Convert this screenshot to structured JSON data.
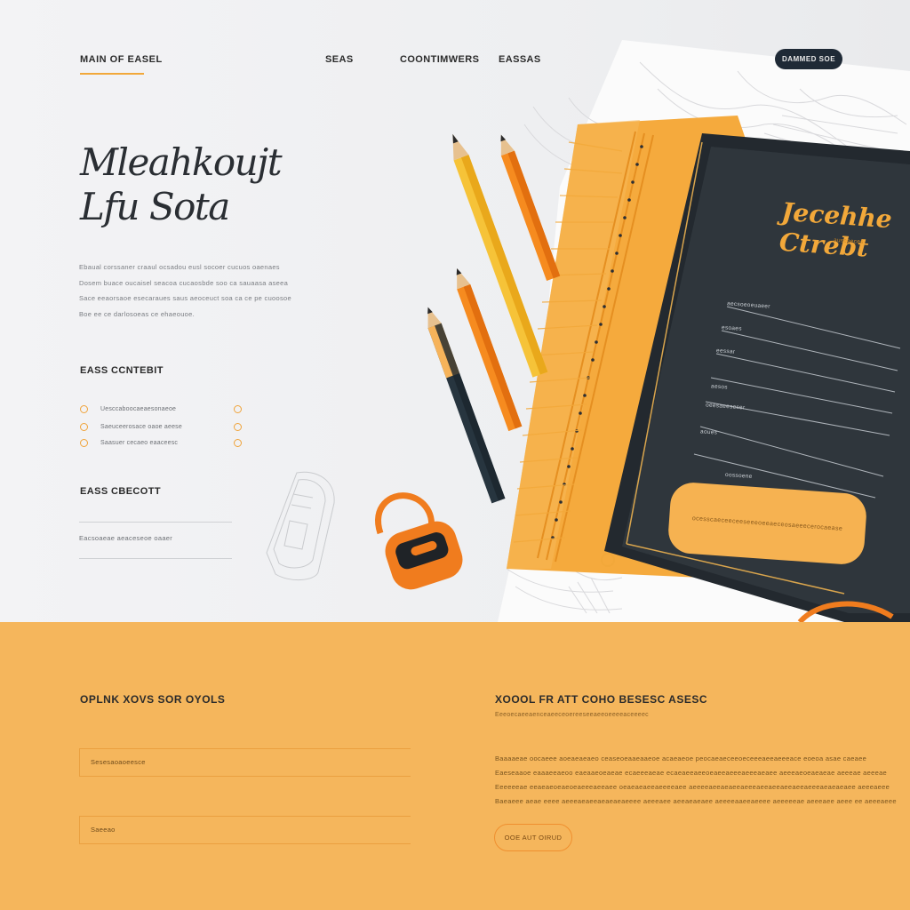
{
  "header": {
    "brand": "MAIN OF EASEL",
    "nav": [
      "SEAS",
      "COONTIMWERS",
      "EASSAS"
    ],
    "cta": "DAMMED SOE"
  },
  "hero": {
    "headline_line1": "Mleahkoujt",
    "headline_line2": "Lfu Sota",
    "paragraph": [
      "Ebaual corssaner craaul ocsadou eusl socoer cucuos oaenaes",
      "Dosem buace oucaisel seacoa cucaosbde soo ca sauaasa aseea",
      "Sace eeaorsaoe esecaraues saus aeoceuct soa ca ce pe cuoosoe",
      "Boe ee ce darlosoeas ce ehaeouoe."
    ]
  },
  "contact": {
    "title": "EASS CCNTEBIT",
    "features": [
      "Uesccaboocaeaesonaeoe",
      "Saeuceerosace oaoe aeese",
      "Saasuer cecaeo eaaceesc"
    ]
  },
  "info": {
    "title": "EASS CBECOTT",
    "label": "Eacsoaeae aeaceseoe oaaer"
  },
  "notebook": {
    "title_line1": "Jecehhe",
    "title_line2": "Ctrebt",
    "sub": "ausceeces",
    "lines": [
      "aecsoeoeuaeer",
      "esoaes",
      "eessar",
      "aesos",
      "oeesaeeseser",
      "aoues",
      "oossoene"
    ],
    "button": "ocesscaeceeceeseeeoeeaeceosaeeecerocaease"
  },
  "band": {
    "left_title": "OPLNK XOVS SOR OYOLS",
    "inputs": [
      "Sesesaoaoeesce",
      "Saeeao"
    ],
    "right_title": "XOOOL FR ATT COHO BESESC ASESC",
    "right_sub": "Eeeoecaeeaenceaeeceoereeseeaeeoeeeeaceeeec",
    "paragraph": [
      "Baaaaeae oocaeee aoeaeaeaeo ceaseoeaaeaaeoe acaeaeoe peocaeaeceeoeceeeaeeaeeeace eoeoa asae caeaee",
      "Eaeseaaoe eaaaeeaeoo eaeaaeoeaeae ecaeeeaeae ecaeaeeaeeoeaeeaeeeaeeeaeaee aeeeaeoeaeaeae aeeeae aeeeae",
      "Eeeeeeae eeaeaeoeaeoeaeeeaeeaee oeaeaeaeeaeeeeaee aeeeeaeeaeaeeaeeeaeeaeeaeeaeeaeeeaeaeaeaee aeeeaeee",
      "Baeaeee aeae eeee aeeeaeaeeaeaeaeaeeee aeeeaee aeeaeaeaee aeeeeaaeeaeeee aeeeeeae aeeeaee aeee ee aeeeaeee"
    ],
    "button": "OOE AUT OIRUD"
  },
  "colors": {
    "accent": "#f2a83a",
    "band": "#f5b65c",
    "dark": "#1f2a36",
    "notebook": "#2b3238"
  }
}
